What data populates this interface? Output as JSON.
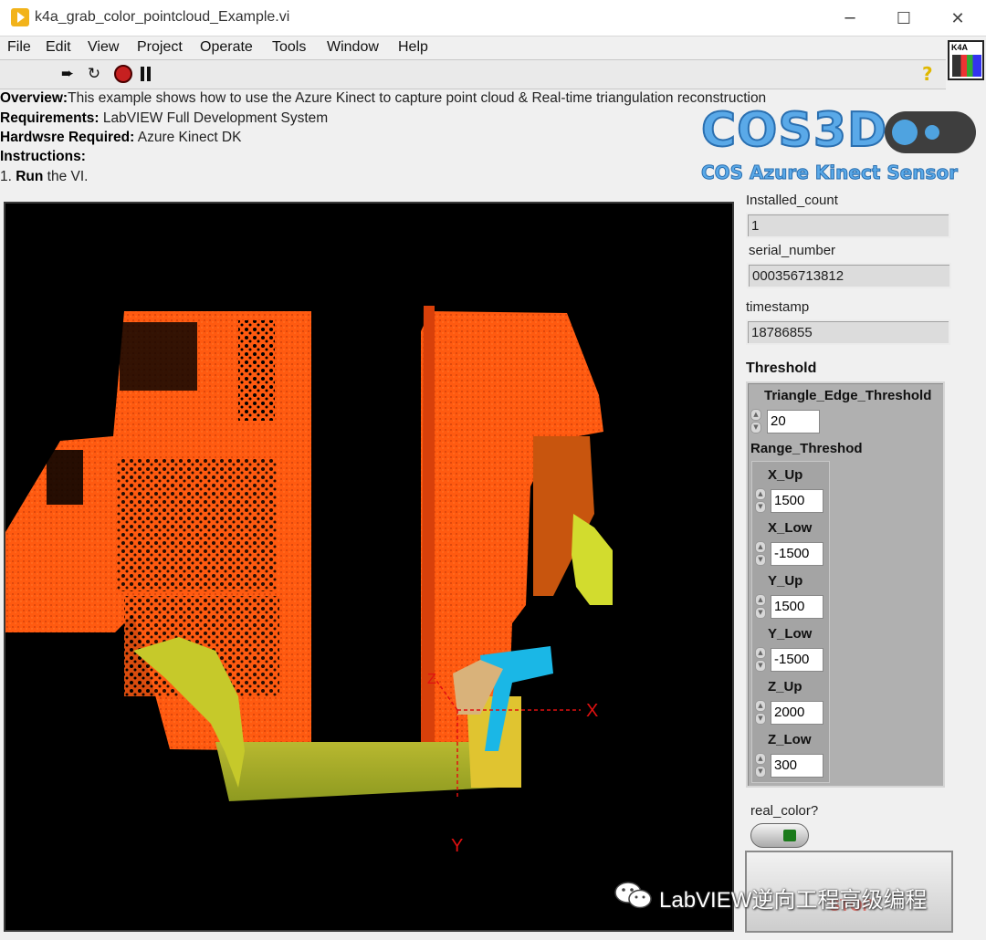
{
  "window": {
    "title": "k4a_grab_color_pointcloud_Example.vi",
    "minimize_glyph": "─",
    "maximize_glyph": "☐",
    "close_glyph": "✕"
  },
  "menu": [
    "File",
    "Edit",
    "View",
    "Project",
    "Operate",
    "Tools",
    "Window",
    "Help"
  ],
  "toolbar": {
    "run_icon": "run-arrow-icon",
    "run_continuously_icon": "run-continuously-icon",
    "abort_icon": "abort-execution-icon",
    "pause_icon": "pause-icon",
    "help_icon": "context-help-icon",
    "run_glyph": "➨",
    "run_continuously_glyph": "↻",
    "help_glyph": "?"
  },
  "vi_icon": {
    "label": "K4A"
  },
  "description": {
    "overview_label": "Overview:",
    "overview_text": "This example shows how to use the Azure Kinect to capture point cloud & Real-time triangulation reconstruction",
    "requirements_label": "Requirements:",
    "requirements_text": " LabVIEW Full Development System",
    "hardware_label": "Hardwsre Required:",
    "hardware_text": " Azure Kinect DK",
    "instructions_label": "Instructions:",
    "step1_prefix": "1. ",
    "step1_bold": "Run",
    "step1_text": " the VI."
  },
  "logo": {
    "main": "COS3D",
    "sub": "COS Azure Kinect Sensor"
  },
  "pointcloud": {
    "axis_x": "X",
    "axis_y": "Y",
    "axis_z": "Z",
    "colors": {
      "orange": "#ff5a10",
      "dark_orange": "#e0400a",
      "yellow": "#d6d43a",
      "cyan": "#1ab7e6",
      "axis_red": "#e01010"
    }
  },
  "indicators": {
    "installed_count_label": "Installed_count",
    "installed_count_value": "1",
    "serial_number_label": "serial_number",
    "serial_number_value": "000356713812",
    "timestamp_label": "timestamp",
    "timestamp_value": "18786855"
  },
  "threshold": {
    "title": "Threshold",
    "triangle_label": "Triangle_Edge_Threshold",
    "triangle_value": "20",
    "range_label": "Range_Threshod",
    "fields": [
      {
        "label": "X_Up",
        "value": "1500"
      },
      {
        "label": "X_Low",
        "value": "-1500"
      },
      {
        "label": "Y_Up",
        "value": "1500"
      },
      {
        "label": "Y_Low",
        "value": "-1500"
      },
      {
        "label": "Z_Up",
        "value": "2000"
      },
      {
        "label": "Z_Low",
        "value": "300"
      }
    ]
  },
  "real_color": {
    "label": "real_color?",
    "state": "on"
  },
  "stop_button": {
    "label": "STOP"
  },
  "watermark": {
    "text": "LabVIEW逆向工程高级编程",
    "icon": "wechat-icon"
  }
}
